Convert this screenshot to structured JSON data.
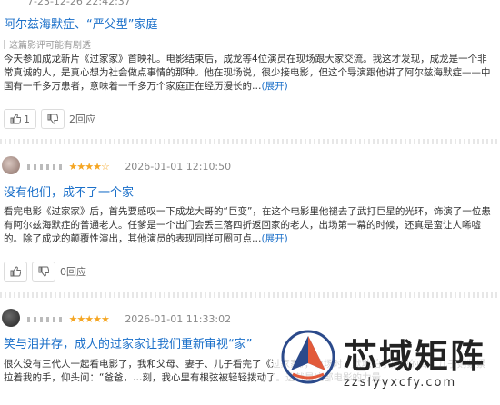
{
  "reviews": [
    {
      "meta_partial": "7-23-12-26 22:42:37",
      "title": "阿尔兹海默症、“严父型”家庭",
      "note": "这篇影评可能有剧透",
      "body": "今天参加成龙新片《过家家》首映礼。电影结束后，成龙等4位演员在现场跟大家交流。我这才发现，成龙是一个非常真诚的人，是真心想为社会做点事情的那种。他在现场说，很少接电影，但这个导演跟他讲了阿尔兹海默症——中国有一千多万患者，意味着一千多万个家庭正在经历漫长的…",
      "expand": "(展开)",
      "like_count": "1",
      "reply_label": "2回应"
    },
    {
      "stars": "★★★★☆",
      "date": "2026-01-01 12:10:50",
      "title": "没有他们，成不了一个家",
      "body": "看完电影《过家家》后，首先要感叹一下成龙大哥的“巨变”，在这个电影里他褪去了武打巨星的光环，饰演了一位患有阿尔兹海默症的普通老人。任爹是一个出门会丢三落四折返回家的老人，出场第一幕的时候，还真是蛮让人唏嘘的。除了成龙的颠覆性演出，其他演员的表现同样可圈可点…",
      "expand": "(展开)",
      "like_count": "",
      "reply_label": "0回应"
    },
    {
      "stars": "★★★★★",
      "date": "2026-01-01 11:33:02",
      "title": "笑与泪并存，成人的过家家让我们重新审视“家”",
      "body": "很久没有三代人一起看电影了，我和父母、妻子、儿子看完了《过家家》，散场时，默地拍了拍我的背，儿子则紧紧拉着我的手，仰头问：“爸爸，…刻，我心里有根弦被轻轻拨动了。这就是这部电影的力量，…"
    }
  ],
  "watermark": {
    "text": "芯域矩阵",
    "url": "zzslyyxcfy.com"
  },
  "colors": {
    "link": "#1a6fc9",
    "star": "#f5a623"
  }
}
